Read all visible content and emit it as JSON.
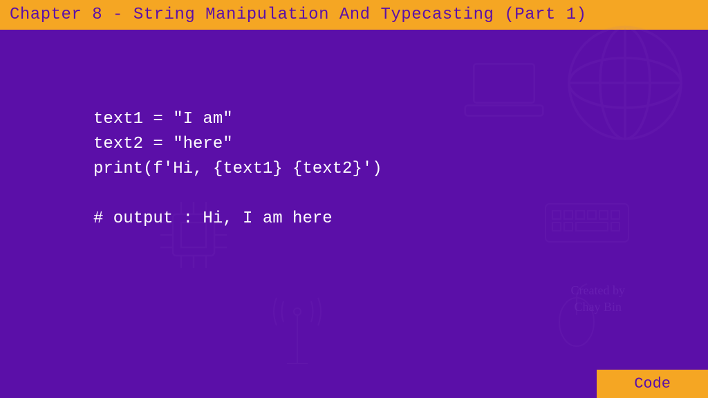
{
  "header": {
    "title": "Chapter 8 - String Manipulation And Typecasting (Part 1)"
  },
  "code": {
    "line1": "text1 = \"I am\"",
    "line2": "text2 = \"here\"",
    "line3": "print(f'Hi, {text1} {text2}')",
    "line4": "",
    "line5": "# output : Hi, I am here"
  },
  "footer": {
    "label": "Code"
  },
  "credit": {
    "line1": "Created by",
    "line2": "Chay Bin"
  }
}
